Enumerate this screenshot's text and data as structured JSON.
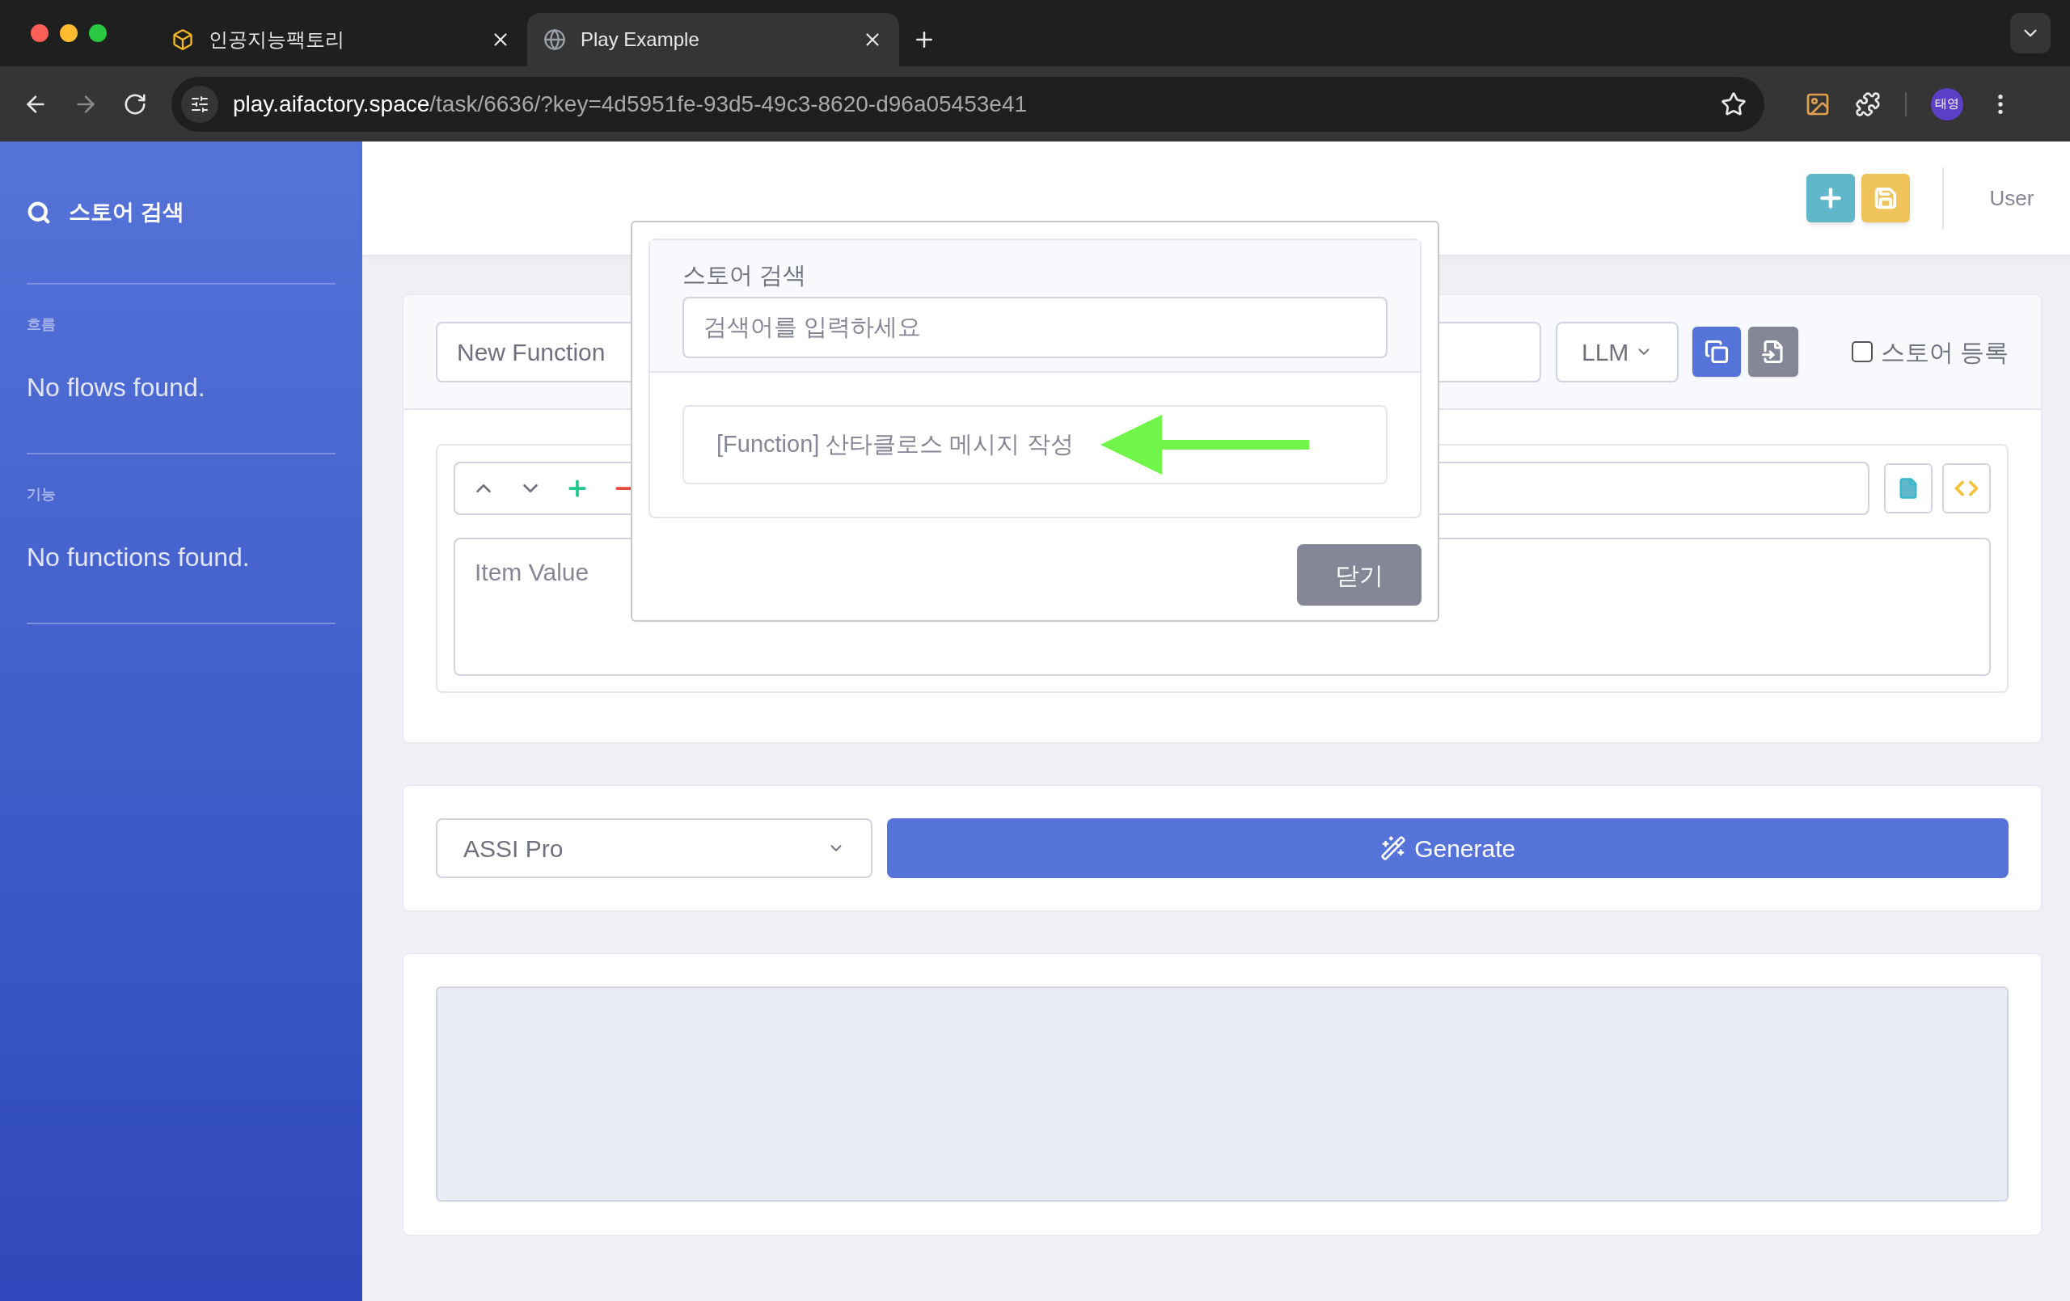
{
  "browser": {
    "tabs": [
      {
        "title": "인공지능팩토리",
        "selected": false,
        "kind": "cube"
      },
      {
        "title": "Play Example",
        "selected": true,
        "kind": "globe"
      }
    ],
    "url_host": "play.aifactory.space",
    "url_path": "/task/6636/?key=4d5951fe-93d5-49c3-8620-d96a05453e41",
    "profile": "태영"
  },
  "sidebar": {
    "search_label": "스토어 검색",
    "sections": [
      {
        "heading": "흐름",
        "empty_text": "No flows found."
      },
      {
        "heading": "기능",
        "empty_text": "No functions found."
      }
    ]
  },
  "header": {
    "user": "User"
  },
  "function_editor": {
    "name_value": "New Function",
    "type_value": "LLM",
    "store_checkbox": {
      "label": "스토어 등록",
      "checked": false
    },
    "items": [
      {
        "placeholder": "Item Value"
      }
    ]
  },
  "generate": {
    "model_value": "ASSI Pro",
    "button": "Generate"
  },
  "store_modal": {
    "title": "스토어 검색",
    "search_placeholder": "검색어를 입력하세요",
    "results": [
      "[Function] 산타클로스 메시지 작성"
    ],
    "close_button": "닫기"
  }
}
